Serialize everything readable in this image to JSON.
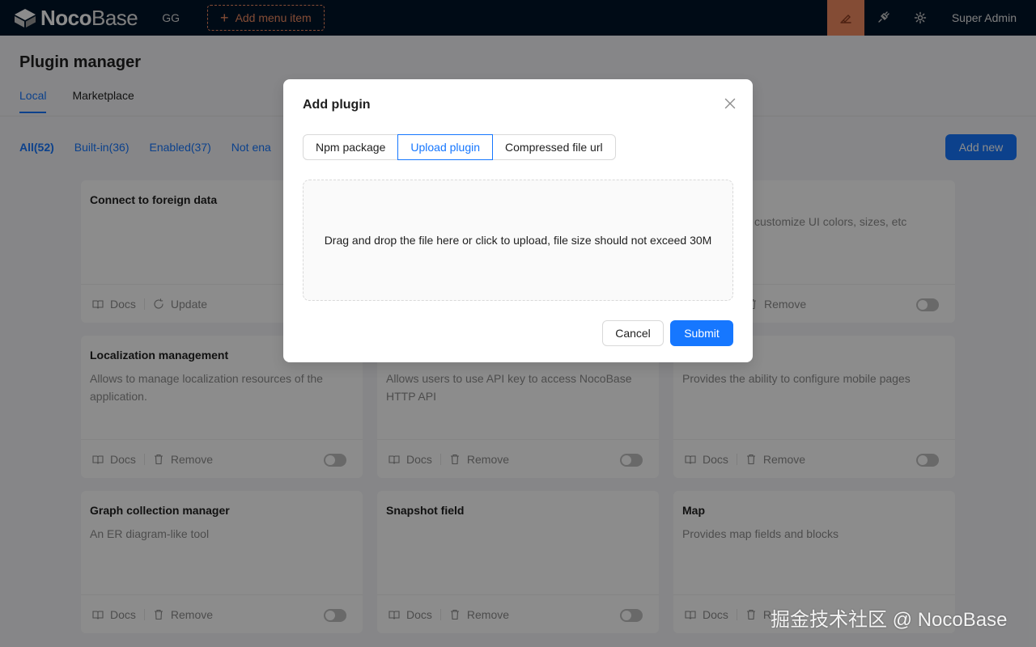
{
  "header": {
    "logo_bold": "Noco",
    "logo_light": "Base",
    "menu_item": "GG",
    "add_menu_label": "Add menu item",
    "user_name": "Super Admin",
    "icons": [
      "highlighter-icon",
      "plugin-icon",
      "gear-icon"
    ]
  },
  "page": {
    "title": "Plugin manager",
    "tabs": [
      {
        "label": "Local",
        "active": true
      },
      {
        "label": "Marketplace",
        "active": false
      }
    ],
    "filters": [
      "All(52)",
      "Built-in(36)",
      "Enabled(37)",
      "Not ena"
    ],
    "add_new_label": "Add new"
  },
  "cards": [
    {
      "title": "Connect to foreign data",
      "desc": "",
      "actions": [
        "Docs",
        "Update"
      ]
    },
    {
      "title": "",
      "desc": "",
      "actions": []
    },
    {
      "title": "",
      "desc": "customize UI colors, sizes, etc",
      "actions": [
        "Remove"
      ]
    },
    {
      "title": "Localization management",
      "desc": "Allows to manage localization resources of the application.",
      "actions": [
        "Docs",
        "Remove"
      ]
    },
    {
      "title": "",
      "desc": "Allows users to use API key to access NocoBase HTTP API",
      "actions": [
        "Docs",
        "Remove"
      ]
    },
    {
      "title": "",
      "desc": "Provides the ability to configure mobile pages",
      "actions": [
        "Docs",
        "Remove"
      ]
    },
    {
      "title": "Graph collection manager",
      "desc": "An ER diagram-like tool",
      "actions": [
        "Docs",
        "Remove"
      ]
    },
    {
      "title": "Snapshot field",
      "desc": "",
      "actions": [
        "Docs",
        "Remove"
      ]
    },
    {
      "title": "Map",
      "desc": "Provides map fields and blocks",
      "actions": [
        "Docs",
        "R"
      ]
    }
  ],
  "modal": {
    "title": "Add plugin",
    "options": [
      {
        "label": "Npm package",
        "active": false
      },
      {
        "label": "Upload plugin",
        "active": true
      },
      {
        "label": "Compressed file url",
        "active": false
      }
    ],
    "dropzone_text": "Drag and drop the file here or click to upload, file size should not exceed 30M",
    "cancel_label": "Cancel",
    "submit_label": "Submit"
  },
  "watermark": "掘金技术社区 @ NocoBase"
}
